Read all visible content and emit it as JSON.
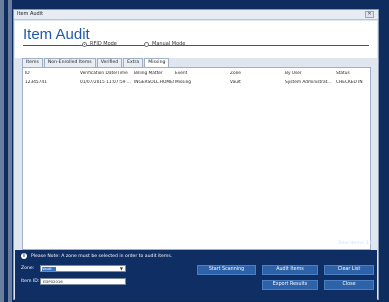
{
  "window": {
    "title": "Item Audit"
  },
  "header": {
    "title": "Item Audit"
  },
  "mode": {
    "rfid_label": "RFID Mode",
    "manual_label": "Manual Mode",
    "selected": "rfid"
  },
  "tabs": [
    {
      "label": "Items"
    },
    {
      "label": "Non-Enrolled Items"
    },
    {
      "label": "Verified"
    },
    {
      "label": "Extra"
    },
    {
      "label": "Missing"
    }
  ],
  "active_tab": "Missing",
  "table": {
    "columns": [
      "ID",
      "Verification Date/Time",
      "Billing Matter",
      "Event",
      "Zone",
      "By User",
      "Status"
    ],
    "rows": [
      [
        "12345741",
        "01/07/2015 11:07:59 ...",
        "INGERSOLL.HOMES...",
        "Missing",
        "Vault",
        "System Administrat...",
        "CHECKED IN"
      ]
    ]
  },
  "total": {
    "text": "Total Items: 11"
  },
  "footer": {
    "note": "Please Note: A zone must be selected in order to audit items.",
    "zone_label": "Zone:",
    "zone_value": "Vault",
    "item_id_label": "Item ID:",
    "item_id_value": "EDP02016",
    "buttons": {
      "start_scanning": "Start Scanning",
      "audit_items": "Audit Items",
      "clear_list": "Clear List",
      "export_results": "Export Results",
      "close": "Close"
    }
  },
  "colors": {
    "accent": "#1e5aa8",
    "footer_bg": "#0f2e64",
    "button": "#2d62a9"
  },
  "icons": {
    "info": "info-icon",
    "close": "close-icon",
    "dropdown": "chevron-down-icon"
  }
}
